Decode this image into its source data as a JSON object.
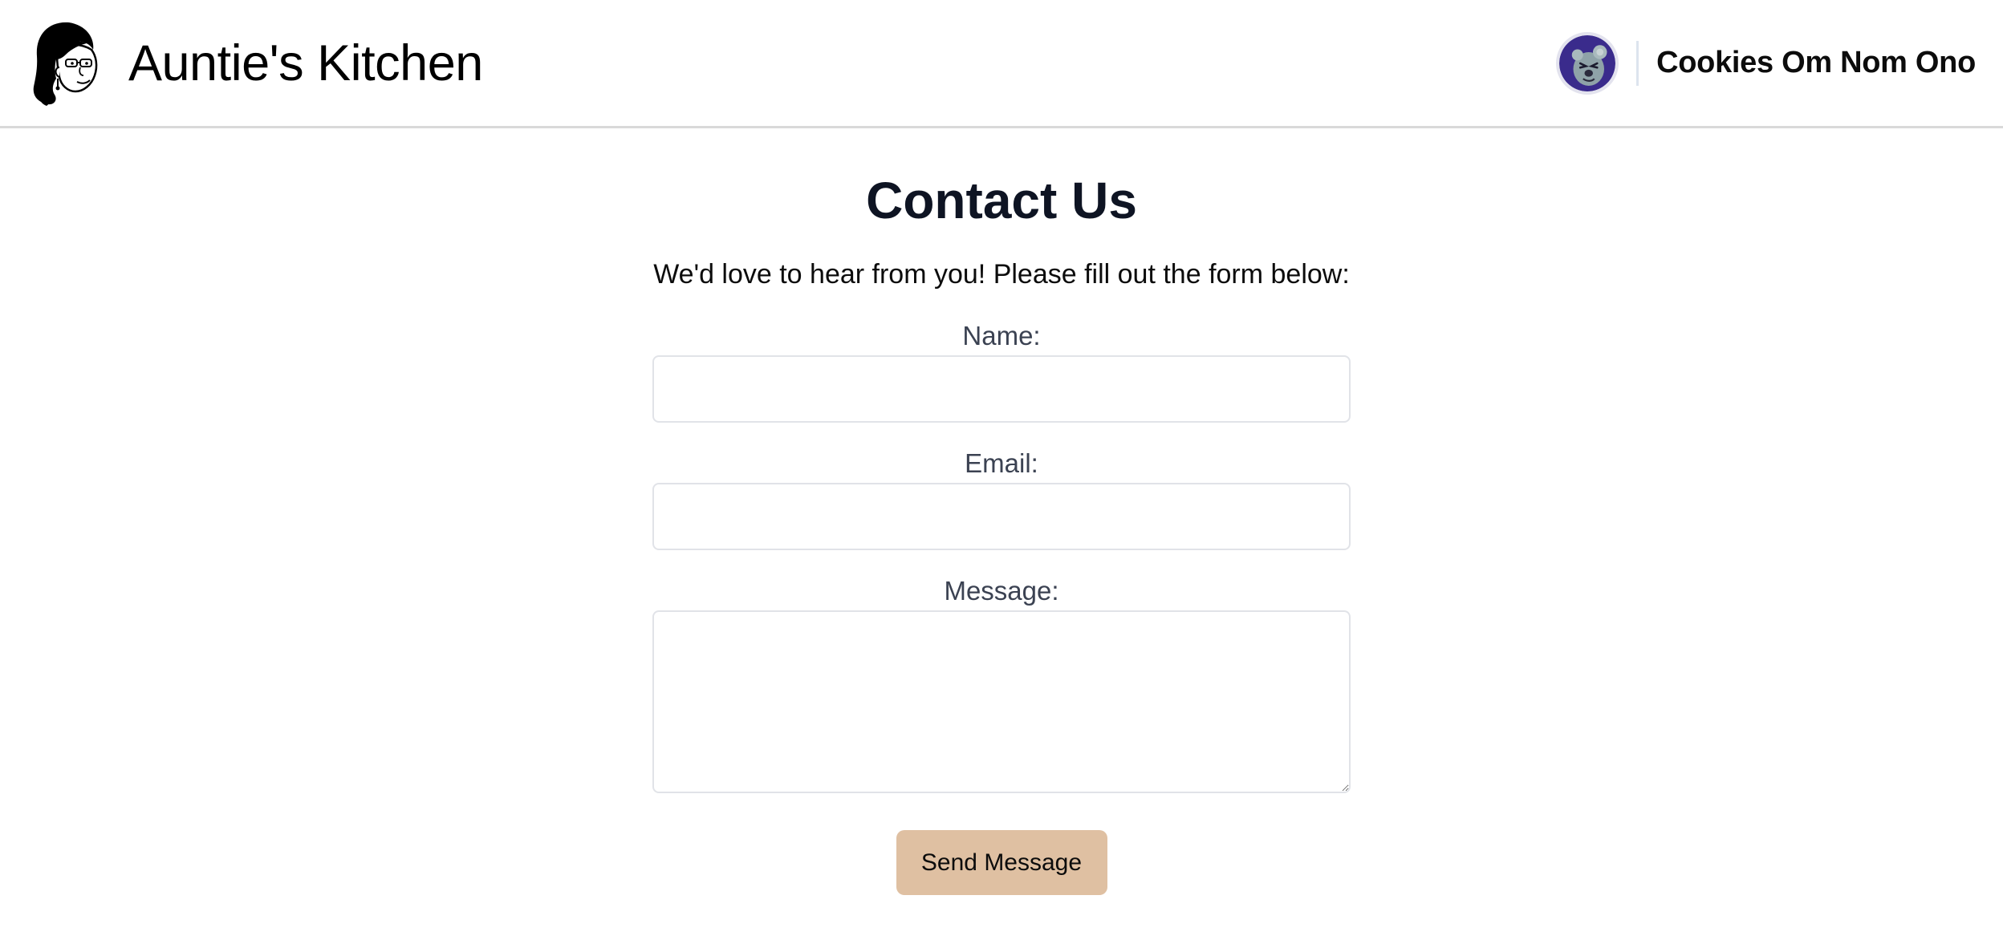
{
  "header": {
    "brand_icon": "auntie-face-logo-icon",
    "brand_title": "Auntie's Kitchen",
    "avatar_icon": "user-avatar-icon",
    "user_name": "Cookies Om Nom Ono"
  },
  "main": {
    "title": "Contact Us",
    "intro": "We'd love to hear from you! Please fill out the form below:"
  },
  "form": {
    "name_label": "Name:",
    "name_value": "",
    "email_label": "Email:",
    "email_value": "",
    "message_label": "Message:",
    "message_value": "",
    "send_label": "Send Message"
  },
  "colors": {
    "button_bg": "#dfc0a2",
    "title_text": "#0e1423",
    "label_text": "#3b4252",
    "avatar_bg": "#3a2b8c"
  }
}
